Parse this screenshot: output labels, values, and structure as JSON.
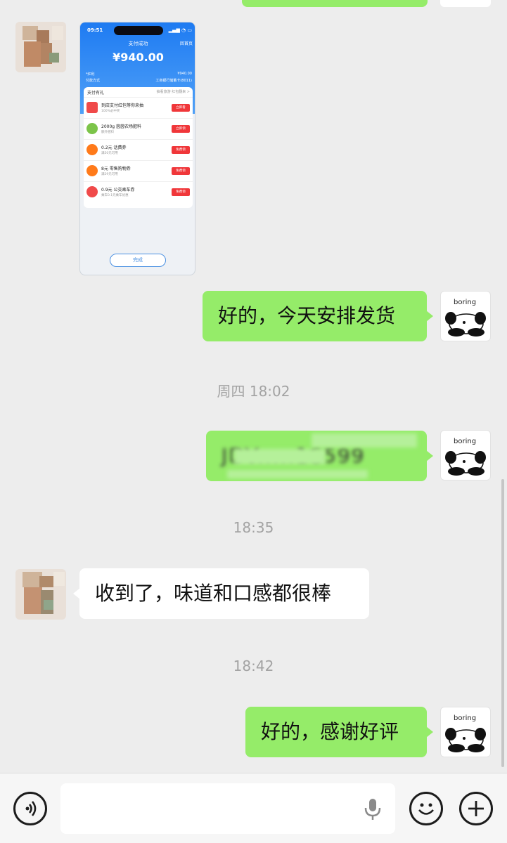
{
  "messages": {
    "screenshot": {
      "title": "支付成功",
      "back_label": "回首页",
      "status_time": "09:51",
      "amount": "¥940.00",
      "summary_rows": [
        {
          "label": "*红利",
          "value": "¥940.00"
        },
        {
          "label": "付款方式",
          "value": "工商银行储蓄卡(8011)"
        }
      ],
      "card_header": "支付有礼",
      "card_header_right": "抽看旅游 红包翻来 >",
      "offers": [
        {
          "title": "到店支付红包等你来抽",
          "sub": "100%必中奖",
          "button": "立即看",
          "color": "#f04a4a"
        },
        {
          "title": "2000g 茵茵农场肥料",
          "sub": "额外肥料",
          "button": "立即领",
          "color": "#7cc44a"
        },
        {
          "title": "0.2元 话费券",
          "sub": "满50元可用",
          "button": "免费领",
          "color": "#ff7a1a"
        },
        {
          "title": "8元 零售购物券",
          "sub": "满29元可用",
          "button": "免费领",
          "color": "#ff7a1a"
        },
        {
          "title": "0.9元 公交乘车券",
          "sub": "乘车0.1元乘车优惠",
          "button": "免费领",
          "color": "#f04a4a"
        }
      ],
      "done_label": "完成"
    },
    "reply_ship": "好的，今天安排发货",
    "time_1": "周四 18:02",
    "tracking_code": "JDV.....16599",
    "time_2": "18:35",
    "received": "收到了，味道和口感都很棒",
    "time_3": "18:42",
    "thanks": "好的，感谢好评"
  },
  "avatar": {
    "seller_text": "boring"
  },
  "input_bar": {
    "voice_icon": "voice-icon",
    "mic_icon": "microphone-icon",
    "emoji_icon": "emoji-icon",
    "plus_icon": "plus-icon"
  },
  "colors": {
    "bubble_green": "#95ec69",
    "background": "#ededed"
  }
}
